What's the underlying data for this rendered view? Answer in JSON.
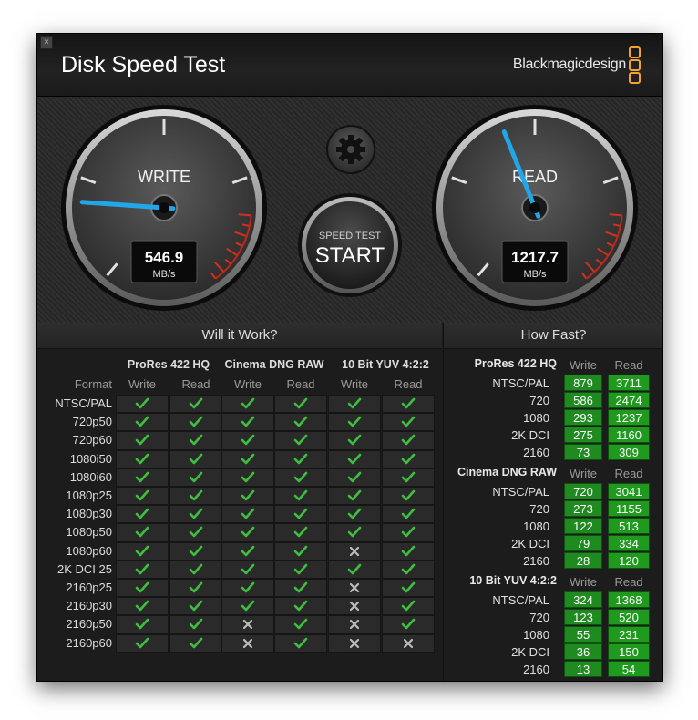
{
  "app": {
    "title": "Disk Speed Test",
    "brand": "Blackmagicdesign"
  },
  "window": {
    "close_glyph": "×"
  },
  "colors": {
    "needle": "#21a7e9",
    "check": "#3fbf3f",
    "cell_bg": "#2a2a2a",
    "value_bg": "#1f8a1f",
    "accent": "#f0a331"
  },
  "gauges": {
    "write": {
      "label": "WRITE",
      "value": "546.9",
      "unit": "MB/s"
    },
    "read": {
      "label": "READ",
      "value": "1217.7",
      "unit": "MB/s"
    }
  },
  "controls": {
    "settings_icon": "gear-icon",
    "start_top": "SPEED TEST",
    "start_main": "START"
  },
  "will_it_work": {
    "title": "Will it Work?",
    "format_header": "Format",
    "groups": [
      "ProRes 422 HQ",
      "Cinema DNG RAW",
      "10 Bit YUV 4:2:2"
    ],
    "subheaders": [
      "Write",
      "Read"
    ],
    "formats": [
      "NTSC/PAL",
      "720p50",
      "720p60",
      "1080i50",
      "1080i60",
      "1080p25",
      "1080p30",
      "1080p50",
      "1080p60",
      "2K DCI 25",
      "2160p25",
      "2160p30",
      "2160p50",
      "2160p60"
    ],
    "results": [
      [
        1,
        1,
        1,
        1,
        1,
        1
      ],
      [
        1,
        1,
        1,
        1,
        1,
        1
      ],
      [
        1,
        1,
        1,
        1,
        1,
        1
      ],
      [
        1,
        1,
        1,
        1,
        1,
        1
      ],
      [
        1,
        1,
        1,
        1,
        1,
        1
      ],
      [
        1,
        1,
        1,
        1,
        1,
        1
      ],
      [
        1,
        1,
        1,
        1,
        1,
        1
      ],
      [
        1,
        1,
        1,
        1,
        1,
        1
      ],
      [
        1,
        1,
        1,
        1,
        0,
        1
      ],
      [
        1,
        1,
        1,
        1,
        1,
        1
      ],
      [
        1,
        1,
        1,
        1,
        0,
        1
      ],
      [
        1,
        1,
        1,
        1,
        0,
        1
      ],
      [
        1,
        1,
        0,
        1,
        0,
        1
      ],
      [
        1,
        1,
        0,
        1,
        0,
        0
      ]
    ]
  },
  "how_fast": {
    "title": "How Fast?",
    "subheaders": [
      "Write",
      "Read"
    ],
    "sections": [
      {
        "name": "ProRes 422 HQ",
        "rows": [
          {
            "format": "NTSC/PAL",
            "write": "879",
            "read": "3711"
          },
          {
            "format": "720",
            "write": "586",
            "read": "2474"
          },
          {
            "format": "1080",
            "write": "293",
            "read": "1237"
          },
          {
            "format": "2K DCI",
            "write": "275",
            "read": "1160"
          },
          {
            "format": "2160",
            "write": "73",
            "read": "309"
          }
        ]
      },
      {
        "name": "Cinema DNG RAW",
        "rows": [
          {
            "format": "NTSC/PAL",
            "write": "720",
            "read": "3041"
          },
          {
            "format": "720",
            "write": "273",
            "read": "1155"
          },
          {
            "format": "1080",
            "write": "122",
            "read": "513"
          },
          {
            "format": "2K DCI",
            "write": "79",
            "read": "334"
          },
          {
            "format": "2160",
            "write": "28",
            "read": "120"
          }
        ]
      },
      {
        "name": "10 Bit YUV 4:2:2",
        "rows": [
          {
            "format": "NTSC/PAL",
            "write": "324",
            "read": "1368"
          },
          {
            "format": "720",
            "write": "123",
            "read": "520"
          },
          {
            "format": "1080",
            "write": "55",
            "read": "231"
          },
          {
            "format": "2K DCI",
            "write": "36",
            "read": "150"
          },
          {
            "format": "2160",
            "write": "13",
            "read": "54"
          }
        ]
      }
    ]
  }
}
